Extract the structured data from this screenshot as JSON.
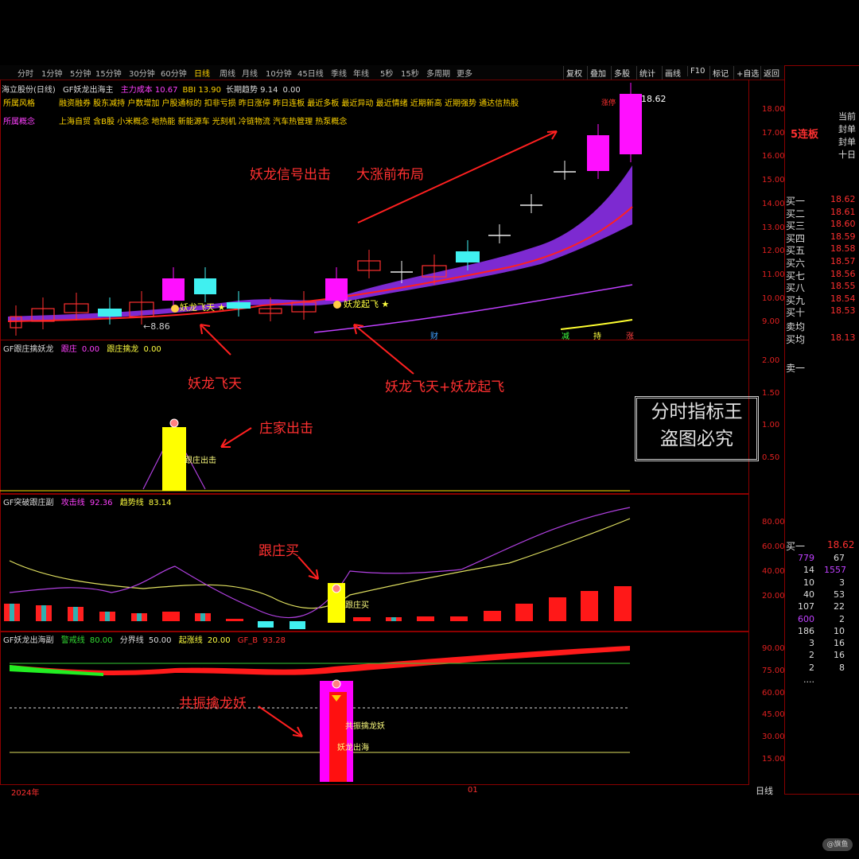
{
  "toolbar": {
    "left": [
      "分时",
      "1分钟",
      "5分钟",
      "15分钟",
      "30分钟",
      "60分钟",
      "日线",
      "周线",
      "月线",
      "10分钟",
      "45日线",
      "季线",
      "年线",
      "5秒",
      "15秒",
      "多周期",
      "更多"
    ],
    "active_index": 6,
    "right": [
      "复权",
      "叠加",
      "多股",
      "统计",
      "画线",
      "F10",
      "标记",
      "+自选",
      "返回"
    ]
  },
  "header": {
    "stock": "海立股份(日线)",
    "main_indicator": "GF妖龙出海主",
    "main_values": [
      {
        "label": "主力成本",
        "value": "10.67"
      },
      {
        "label": "BBI",
        "value": "13.90"
      },
      {
        "label": "长期趋势",
        "value": "9.14"
      },
      {
        "label": "",
        "value": "0.00"
      }
    ],
    "style_label": "所属风格",
    "style_text": "融资融券 股东减持 户数增加 户股通标的 扣非亏损 昨日涨停 昨日连板 最近多板 最近异动 最近情绪 近期新高 近期强势 通达信热股",
    "concept_label": "所属概念",
    "concept_text": "上海自贸 含B股 小米概念 地热能 新能源车 光刻机 冷链物流 汽车热管理 热泵概念"
  },
  "panels": {
    "p2": {
      "name": "GF跟庄擒妖龙",
      "items": [
        {
          "label": "跟庄",
          "value": "0.00"
        },
        {
          "label": "跟庄擒龙",
          "value": "0.00"
        }
      ],
      "signal": "跟庄出击"
    },
    "p3": {
      "name": "GF突破跟庄副",
      "items": [
        {
          "label": "攻击线",
          "value": "92.36"
        },
        {
          "label": "趋势线",
          "value": "83.14"
        }
      ],
      "signal": "跟庄买"
    },
    "p4": {
      "name": "GF妖龙出海副",
      "items": [
        {
          "label": "警戒线",
          "value": "80.00"
        },
        {
          "label": "分界线",
          "value": "50.00"
        },
        {
          "label": "起涨线",
          "value": "20.00"
        },
        {
          "label": "GF_B",
          "value": "93.28"
        }
      ],
      "signal1": "共振擒龙妖",
      "signal2": "妖龙出海"
    }
  },
  "axes": {
    "p1": [
      "18.00",
      "17.00",
      "16.00",
      "15.00",
      "14.00",
      "13.00",
      "12.00",
      "11.00",
      "10.00",
      "9.00"
    ],
    "p2": [
      "2.00",
      "1.50",
      "1.00",
      "0.50"
    ],
    "p3": [
      "80.00",
      "60.00",
      "40.00",
      "20.00"
    ],
    "p4": [
      "90.00",
      "75.00",
      "60.00",
      "45.00",
      "30.00",
      "15.00"
    ],
    "x_left": "2024年",
    "x_mid": "01",
    "period": "日线"
  },
  "chart_marks": {
    "high_label": "18.62",
    "low_label": "8.86",
    "high_tag": "涨停",
    "tag1": "妖龙飞天",
    "tag2": "妖龙起飞",
    "bottom_tags": [
      "财",
      "减",
      "持",
      "涨"
    ]
  },
  "annotations": {
    "a1": "妖龙信号出击",
    "a2": "大涨前布局",
    "a3": "妖龙飞天",
    "a4": "妖龙飞天+妖龙起飞",
    "a5": "庄家出击",
    "a6": "跟庄买",
    "a7": "共振擒龙妖"
  },
  "watermark": {
    "line1": "分时指标王",
    "line2": "盗图必究"
  },
  "sidebar": {
    "lianban": "5连板",
    "info": [
      "当前",
      "封单",
      "封单",
      "十日"
    ],
    "buy_levels": [
      {
        "label": "买一",
        "price": "18.62"
      },
      {
        "label": "买二",
        "price": "18.61"
      },
      {
        "label": "买三",
        "price": "18.60"
      },
      {
        "label": "买四",
        "price": "18.59"
      },
      {
        "label": "买五",
        "price": "18.58"
      },
      {
        "label": "买六",
        "price": "18.57"
      },
      {
        "label": "买七",
        "price": "18.56"
      },
      {
        "label": "买八",
        "price": "18.55"
      },
      {
        "label": "买九",
        "price": "18.54"
      },
      {
        "label": "买十",
        "price": "18.53"
      }
    ],
    "sell_avg": {
      "label": "卖均",
      "price": ""
    },
    "buy_avg": {
      "label": "买均",
      "price": "18.13"
    },
    "sell_one": "卖一",
    "buy_one2": {
      "label": "买一",
      "price": "18.62"
    },
    "queue": [
      [
        "779",
        "67"
      ],
      [
        "14",
        "1557"
      ],
      [
        "10",
        "3"
      ],
      [
        "40",
        "53"
      ],
      [
        "107",
        "22"
      ],
      [
        "600",
        "2"
      ],
      [
        "186",
        "10"
      ],
      [
        "3",
        "16"
      ],
      [
        "2",
        "16"
      ],
      [
        "2",
        "8"
      ],
      [
        "....",
        ""
      ]
    ]
  },
  "corner_logo": "@旗鱼",
  "colors": {
    "up": "#ff2020",
    "down": "#20e0e0",
    "magenta": "#ff00ff",
    "yellow": "#ffff00",
    "grid": "#8b0000"
  }
}
